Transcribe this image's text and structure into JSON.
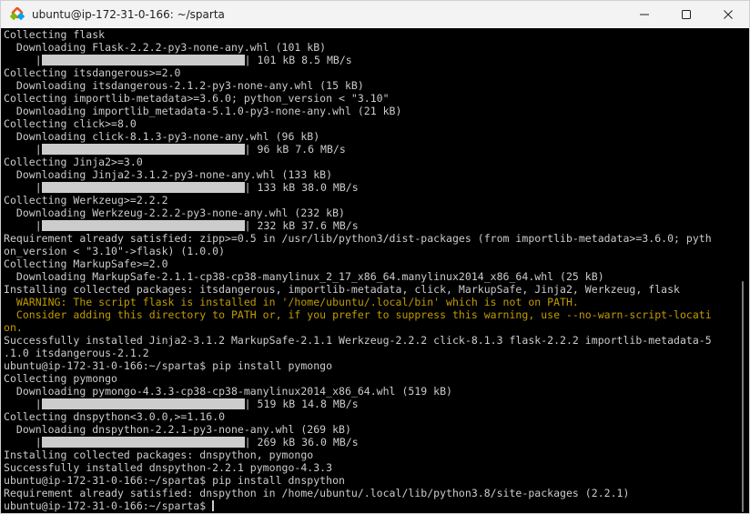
{
  "window": {
    "title": "ubuntu@ip-172-31-0-166: ~/sparta",
    "icon": "penguin-terminal-icon",
    "controls": [
      "minimize-icon",
      "maximize-icon",
      "close-icon"
    ]
  },
  "terminal": {
    "colors": {
      "background": "#000000",
      "text": "#cccccc",
      "warning": "#c19c00",
      "progress": "#cccccc"
    },
    "lines": [
      {
        "text": "Collecting flask"
      },
      {
        "text": "  Downloading Flask-2.2.2-py3-none-any.whl (101 kB)"
      },
      {
        "pre": "     |",
        "bar": true,
        "post": "| 101 kB 8.5 MB/s",
        "progress": 1.0
      },
      {
        "text": "Collecting itsdangerous>=2.0"
      },
      {
        "text": "  Downloading itsdangerous-2.1.2-py3-none-any.whl (15 kB)"
      },
      {
        "text": "Collecting importlib-metadata>=3.6.0; python_version < \"3.10\""
      },
      {
        "text": "  Downloading importlib_metadata-5.1.0-py3-none-any.whl (21 kB)"
      },
      {
        "text": "Collecting click>=8.0"
      },
      {
        "text": "  Downloading click-8.1.3-py3-none-any.whl (96 kB)"
      },
      {
        "pre": "     |",
        "bar": true,
        "post": "| 96 kB 7.6 MB/s",
        "progress": 1.0
      },
      {
        "text": "Collecting Jinja2>=3.0"
      },
      {
        "text": "  Downloading Jinja2-3.1.2-py3-none-any.whl (133 kB)"
      },
      {
        "pre": "     |",
        "bar": true,
        "post": "| 133 kB 38.0 MB/s",
        "progress": 1.0
      },
      {
        "text": "Collecting Werkzeug>=2.2.2"
      },
      {
        "text": "  Downloading Werkzeug-2.2.2-py3-none-any.whl (232 kB)"
      },
      {
        "pre": "     |",
        "bar": true,
        "post": "| 232 kB 37.6 MB/s",
        "progress": 1.0
      },
      {
        "text": "Requirement already satisfied: zipp>=0.5 in /usr/lib/python3/dist-packages (from importlib-metadata>=3.6.0; pyth"
      },
      {
        "text": "on_version < \"3.10\"->flask) (1.0.0)"
      },
      {
        "text": "Collecting MarkupSafe>=2.0"
      },
      {
        "text": "  Downloading MarkupSafe-2.1.1-cp38-cp38-manylinux_2_17_x86_64.manylinux2014_x86_64.whl (25 kB)"
      },
      {
        "text": "Installing collected packages: itsdangerous, importlib-metadata, click, MarkupSafe, Jinja2, Werkzeug, flask"
      },
      {
        "text": "  WARNING: The script flask is installed in '/home/ubuntu/.local/bin' which is not on PATH.",
        "warn": true
      },
      {
        "text": "  Consider adding this directory to PATH or, if you prefer to suppress this warning, use --no-warn-script-locati",
        "warn": true
      },
      {
        "text": "on.",
        "warn": true
      },
      {
        "text": "Successfully installed Jinja2-3.1.2 MarkupSafe-2.1.1 Werkzeug-2.2.2 click-8.1.3 flask-2.2.2 importlib-metadata-5"
      },
      {
        "text": ".1.0 itsdangerous-2.1.2"
      },
      {
        "text": "ubuntu@ip-172-31-0-166:~/sparta$ pip install pymongo"
      },
      {
        "text": "Collecting pymongo"
      },
      {
        "text": "  Downloading pymongo-4.3.3-cp38-cp38-manylinux2014_x86_64.whl (519 kB)"
      },
      {
        "pre": "     |",
        "bar": true,
        "post": "| 519 kB 14.8 MB/s",
        "progress": 1.0
      },
      {
        "text": "Collecting dnspython<3.0.0,>=1.16.0"
      },
      {
        "text": "  Downloading dnspython-2.2.1-py3-none-any.whl (269 kB)"
      },
      {
        "pre": "     |",
        "bar": true,
        "post": "| 269 kB 36.0 MB/s",
        "progress": 1.0
      },
      {
        "text": "Installing collected packages: dnspython, pymongo"
      },
      {
        "text": "Successfully installed dnspython-2.2.1 pymongo-4.3.3"
      },
      {
        "text": "ubuntu@ip-172-31-0-166:~/sparta$ pip install dnspython"
      },
      {
        "text": "Requirement already satisfied: dnspython in /home/ubuntu/.local/lib/python3.8/site-packages (2.2.1)"
      },
      {
        "text": "ubuntu@ip-172-31-0-166:~/sparta$ ",
        "cursor": true
      }
    ]
  }
}
